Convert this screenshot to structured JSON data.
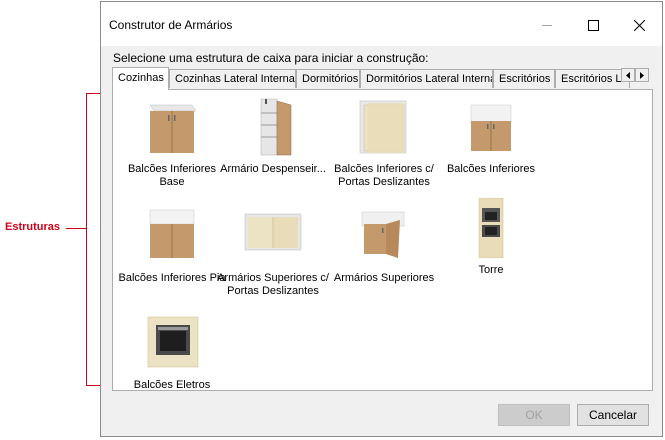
{
  "annotation": {
    "label": "Estruturas",
    "color": "#d0021b"
  },
  "window": {
    "title": "Construtor de Armários"
  },
  "prompt": "Selecione uma estrutura de caixa para iniciar a construção:",
  "tabs": [
    {
      "label": "Cozinhas",
      "active": true
    },
    {
      "label": "Cozinhas Lateral Interna",
      "active": false
    },
    {
      "label": "Dormitórios",
      "active": false
    },
    {
      "label": "Dormitórios Lateral Interna",
      "active": false
    },
    {
      "label": "Escritórios",
      "active": false
    },
    {
      "label": "Escritórios La",
      "active": false
    }
  ],
  "structures": [
    {
      "label": "Balcões Inferiores Base",
      "icon": "base-cabinet-icon"
    },
    {
      "label": "Armário Despenseir...",
      "icon": "pantry-cabinet-icon"
    },
    {
      "label": "Balcões Inferiores c/ Portas Deslizantes",
      "icon": "sliding-door-cabinet-icon"
    },
    {
      "label": "Balcões Inferiores",
      "icon": "lower-cabinet-icon"
    },
    {
      "label": "Balcões Inferiores Pia",
      "icon": "sink-cabinet-icon"
    },
    {
      "label": "Armários Superiores c/ Portas Deslizantes",
      "icon": "upper-sliding-cabinet-icon"
    },
    {
      "label": "Armários Superiores",
      "icon": "upper-cabinet-icon"
    },
    {
      "label": "Torre",
      "icon": "tower-cabinet-icon"
    },
    {
      "label": "Balcões Eletros",
      "icon": "appliance-cabinet-icon"
    }
  ],
  "buttons": {
    "ok": "OK",
    "cancel": "Cancelar"
  }
}
